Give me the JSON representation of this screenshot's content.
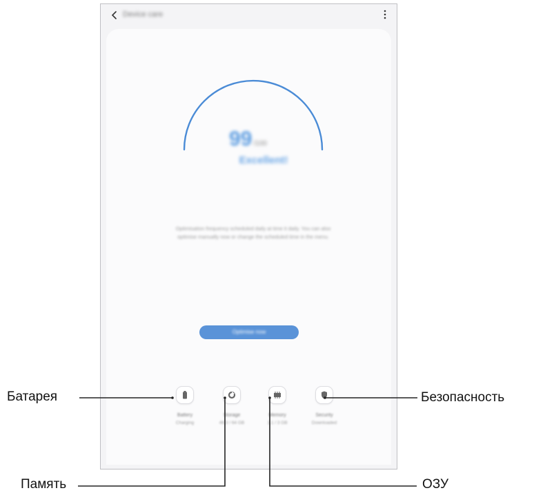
{
  "app": {
    "title": "Device care",
    "back_icon": "chevron-left-icon",
    "more_icon": "more-vert-icon"
  },
  "score": {
    "value": "99",
    "max": "/100",
    "status": "Excellent!",
    "fraction": 0.99
  },
  "description": "Optimisation frequency scheduled daily at time it daily. You can also optimise manually now or change the scheduled time in the menu.",
  "optimize_button": "Optimise now",
  "categories": [
    {
      "label": "Battery",
      "sub": "Charging",
      "icon": "battery-icon"
    },
    {
      "label": "Storage",
      "sub": "46.3 / 64 GB",
      "icon": "storage-pie-icon"
    },
    {
      "label": "Memory",
      "sub": "1.1 / 3 GB",
      "icon": "memory-chip-icon"
    },
    {
      "label": "Security",
      "sub": "Downloaded",
      "icon": "shield-icon"
    }
  ],
  "callouts": {
    "battery": "Батарея",
    "security": "Безопасность",
    "storage": "Память",
    "ram": "ОЗУ"
  },
  "colors": {
    "accent": "#5a93d8",
    "screen_bg": "#f4f4f6",
    "card_bg": "#fbfbfc"
  }
}
